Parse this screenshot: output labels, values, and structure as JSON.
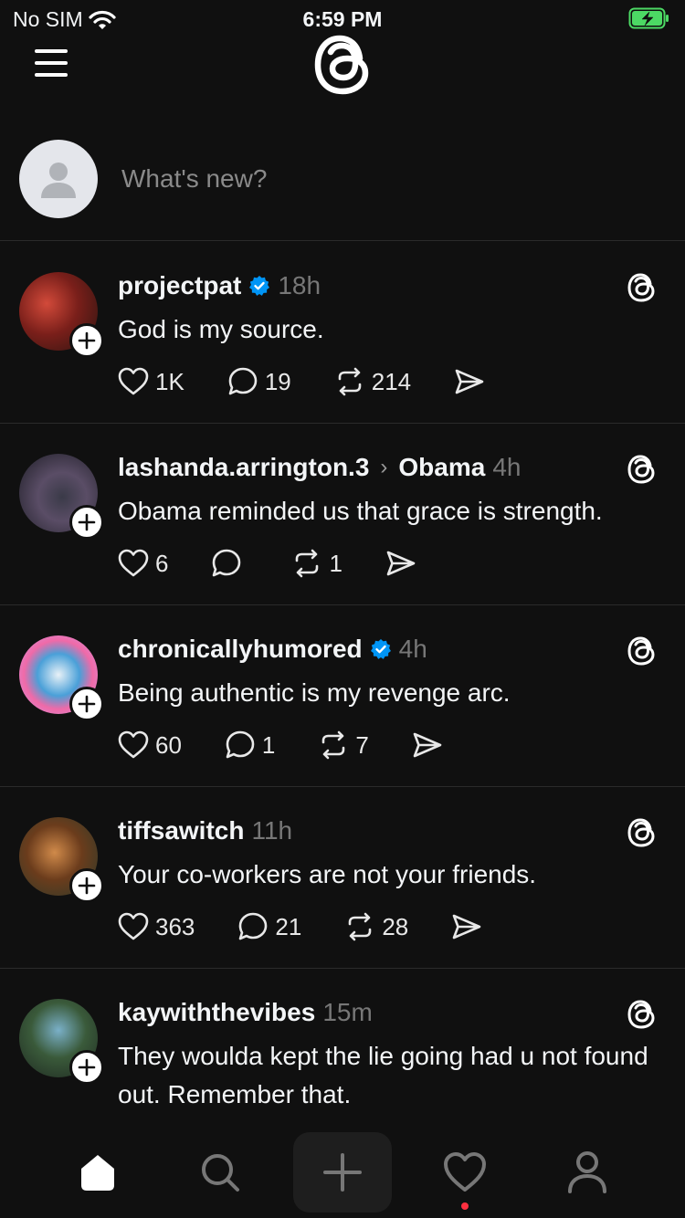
{
  "status_bar": {
    "carrier": "No SIM",
    "time": "6:59 PM"
  },
  "composer": {
    "placeholder": "What's new?"
  },
  "posts": [
    {
      "username": "projectpat",
      "verified": true,
      "reply_to": "",
      "time": "18h",
      "text": "God is my source.",
      "likes": "1K",
      "replies": "19",
      "reposts": "214"
    },
    {
      "username": "lashanda.arrington.3",
      "verified": false,
      "reply_to": "Obama",
      "time": "4h",
      "text": "Obama reminded us that grace is strength.",
      "likes": "6",
      "replies": "",
      "reposts": "1"
    },
    {
      "username": "chronicallyhumored",
      "verified": true,
      "reply_to": "",
      "time": "4h",
      "text": "Being authentic is my revenge arc.",
      "likes": "60",
      "replies": "1",
      "reposts": "7"
    },
    {
      "username": "tiffsawitch",
      "verified": false,
      "reply_to": "",
      "time": "11h",
      "text": "Your co-workers are not your friends.",
      "likes": "363",
      "replies": "21",
      "reposts": "28"
    },
    {
      "username": "kaywiththevibes",
      "verified": false,
      "reply_to": "",
      "time": "15m",
      "text": "They woulda kept the lie going had u not found out. Remember that.",
      "likes": "",
      "replies": "",
      "reposts": ""
    }
  ],
  "colors": {
    "background": "#101010",
    "text": "#f3f5f7",
    "muted": "#777777",
    "verified_blue": "#0095f6",
    "notification_dot": "#ff3040",
    "battery_green": "#4cd964"
  },
  "icons": {
    "header": [
      "menu-icon",
      "threads-logo"
    ],
    "tabs": [
      "home-icon",
      "search-icon",
      "plus-icon",
      "heart-icon",
      "profile-icon"
    ]
  }
}
